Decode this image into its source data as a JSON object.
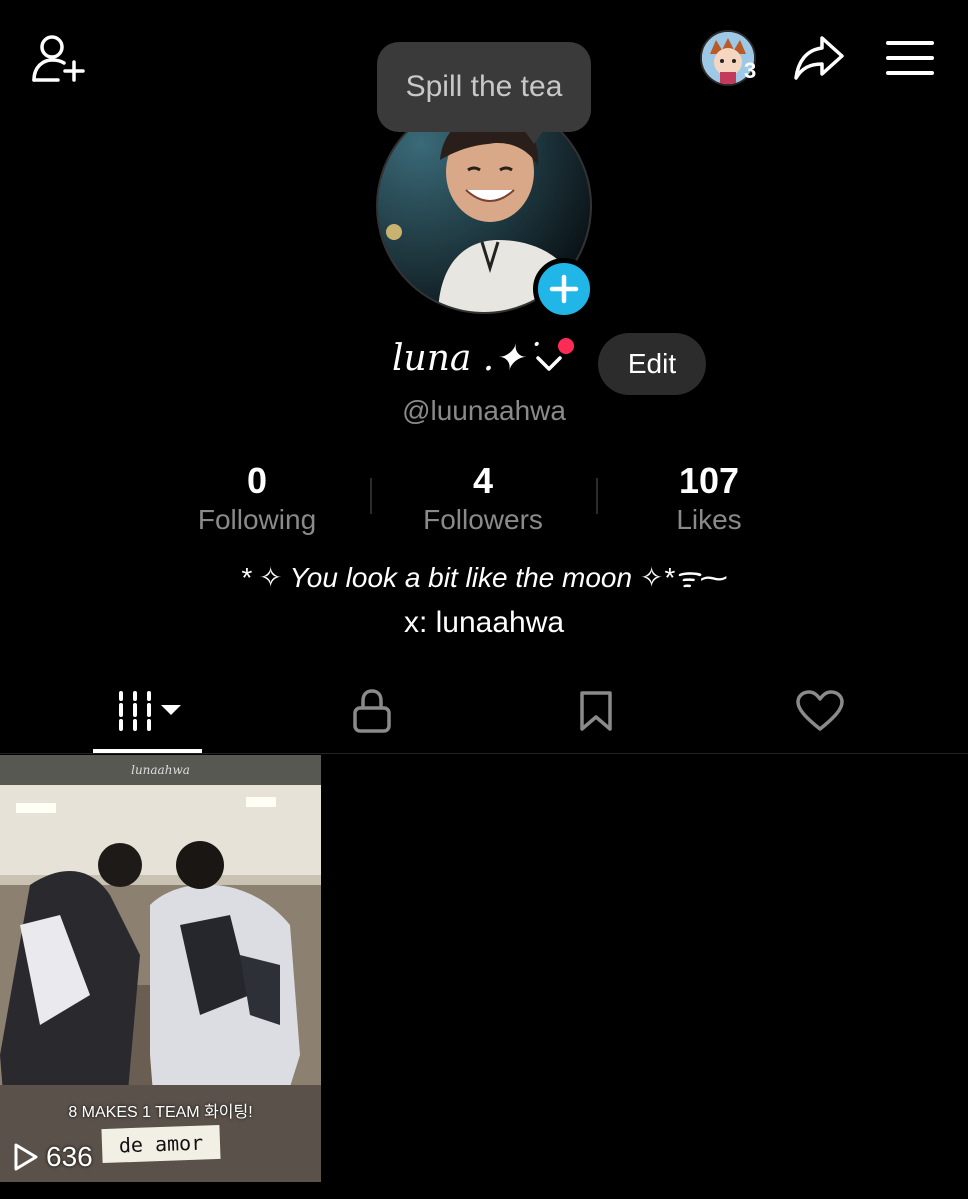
{
  "topbar": {
    "add_friend_icon": "person-plus-icon",
    "friends_count": "3",
    "share_icon": "share-arrow-icon",
    "menu_icon": "hamburger-menu-icon"
  },
  "tooltip": {
    "text": "Spill the tea"
  },
  "profile": {
    "display_name": "luna .✦˙",
    "edit_label": "Edit",
    "handle": "@luunaahwa",
    "stats": [
      {
        "value": "0",
        "label": "Following"
      },
      {
        "value": "4",
        "label": "Followers"
      },
      {
        "value": "107",
        "label": "Likes"
      }
    ],
    "bio": "* ✧ You look a bit like the moon ✧*ᯤ⁓",
    "bio_link": "x: lunaahwa"
  },
  "tabs": [
    {
      "name": "videos",
      "icon": "grid-bars-icon",
      "active": true
    },
    {
      "name": "private",
      "icon": "lock-icon"
    },
    {
      "name": "saved",
      "icon": "bookmark-icon"
    },
    {
      "name": "liked",
      "icon": "heart-icon"
    }
  ],
  "videos": [
    {
      "channel": "lunaahwa",
      "caption": "8 MAKES 1 TEAM 화이팅!",
      "tag": "de amor",
      "play_count": "636"
    }
  ],
  "colors": {
    "background": "#000000",
    "accent_blue": "#20b6e8",
    "notification_red": "#fe2c55",
    "muted_text": "#8a8a8a"
  }
}
